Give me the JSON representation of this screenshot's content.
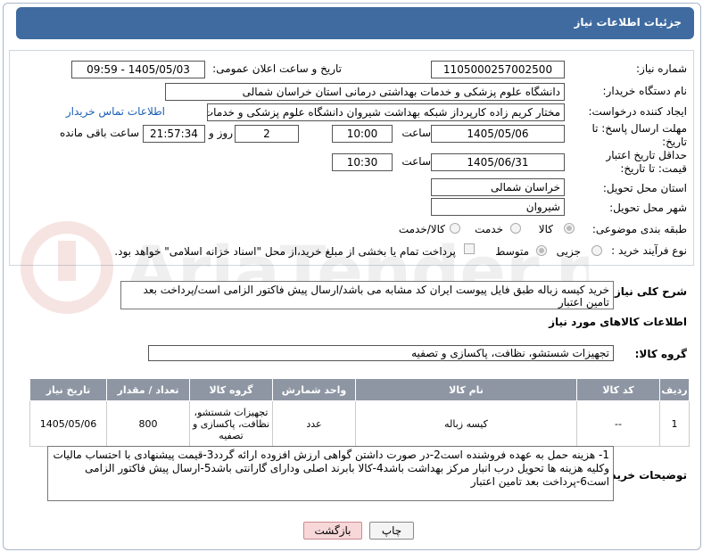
{
  "header": {
    "title": "جزئیات اطلاعات نیاز"
  },
  "fields": {
    "need_number_label": "شماره نیاز:",
    "need_number": "1105000257002500",
    "announce_label": "تاریخ و ساعت اعلان عمومی:",
    "announce_value": "1405/05/03 - 09:59",
    "buyer_org_label": "نام دستگاه خریدار:",
    "buyer_org": "دانشگاه علوم پزشکی و خدمات بهداشتی درمانی استان خراسان شمالی",
    "creator_label": "ایجاد کننده درخواست:",
    "creator": "مختار کریم زاده کارپرداز شبکه بهداشت شیروان دانشگاه علوم پزشکی و خدمات",
    "contact_link": "اطلاعات تماس خریدار",
    "reply_deadline_label": "مهلت ارسال پاسخ: تا تاریخ:",
    "reply_date": "1405/05/06",
    "time_label": "ساعت",
    "reply_time": "10:00",
    "days_value": "2",
    "days_label": "روز و",
    "remaining_time": "21:57:34",
    "remaining_label": "ساعت باقی مانده",
    "validity_label": "حداقل تاریخ اعتبار قیمت: تا تاریخ:",
    "validity_date": "1405/06/31",
    "validity_time": "10:30",
    "province_label": "استان محل تحویل:",
    "province": "خراسان شمالی",
    "city_label": "شهر محل تحویل:",
    "city": "شیروان",
    "category_label": "طبقه بندی موضوعی:",
    "category_options": [
      "کالا",
      "خدمت",
      "کالا/خدمت"
    ],
    "process_label": "نوع فرآیند خرید :",
    "process_options": [
      "جزیی",
      "متوسط"
    ],
    "payment_note": "پرداخت تمام یا بخشی از مبلغ خرید،از محل \"اسناد خزانه اسلامی\" خواهد بود."
  },
  "description": {
    "label": "شرح کلی نیاز:",
    "text": "خرید کیسه زباله طبق فایل پیوست ایران کد مشابه می باشد/ارسال پیش فاکتور الزامی است/پرداخت بعد تامین اعتبار"
  },
  "goods": {
    "section_title": "اطلاعات کالاهای مورد نیاز",
    "group_label": "گروه کالا:",
    "group_value": "تجهیزات شستشو، نظافت، پاکسازی و تصفیه",
    "columns": [
      "ردیف",
      "کد کالا",
      "نام کالا",
      "واحد شمارش",
      "گروه کالا",
      "تعداد / مقدار",
      "تاریخ نیاز"
    ],
    "rows": [
      {
        "row": "1",
        "code": "--",
        "name": "کیسه زباله",
        "unit": "عدد",
        "group": "تجهیزات شستشو، نظافت، پاکسازی و تصفیه",
        "qty": "800",
        "date": "1405/05/06"
      }
    ]
  },
  "buyer_notes": {
    "label": "توضیحات خریدار:",
    "text": "1- هزینه حمل به عهده فروشنده است2-در صورت داشتن گواهی ارزش افزوده ارائه گردد3-قیمت پیشنهادی با احتساب مالیات وکلیه هزینه ها تحویل درب انبار مرکز بهداشت  باشد4-کالا بابرند اصلی ودارای گارانتی  باشد5-ارسال پیش فاکتور الزامی است6-پرداخت بعد تامین اعتبار"
  },
  "buttons": {
    "print": "چاپ",
    "back": "بازگشت"
  },
  "colors": {
    "header": "#3f6ba0",
    "table_header": "#8e96a3",
    "link": "#1a5fb4",
    "back_button": "#f8d7d9"
  }
}
